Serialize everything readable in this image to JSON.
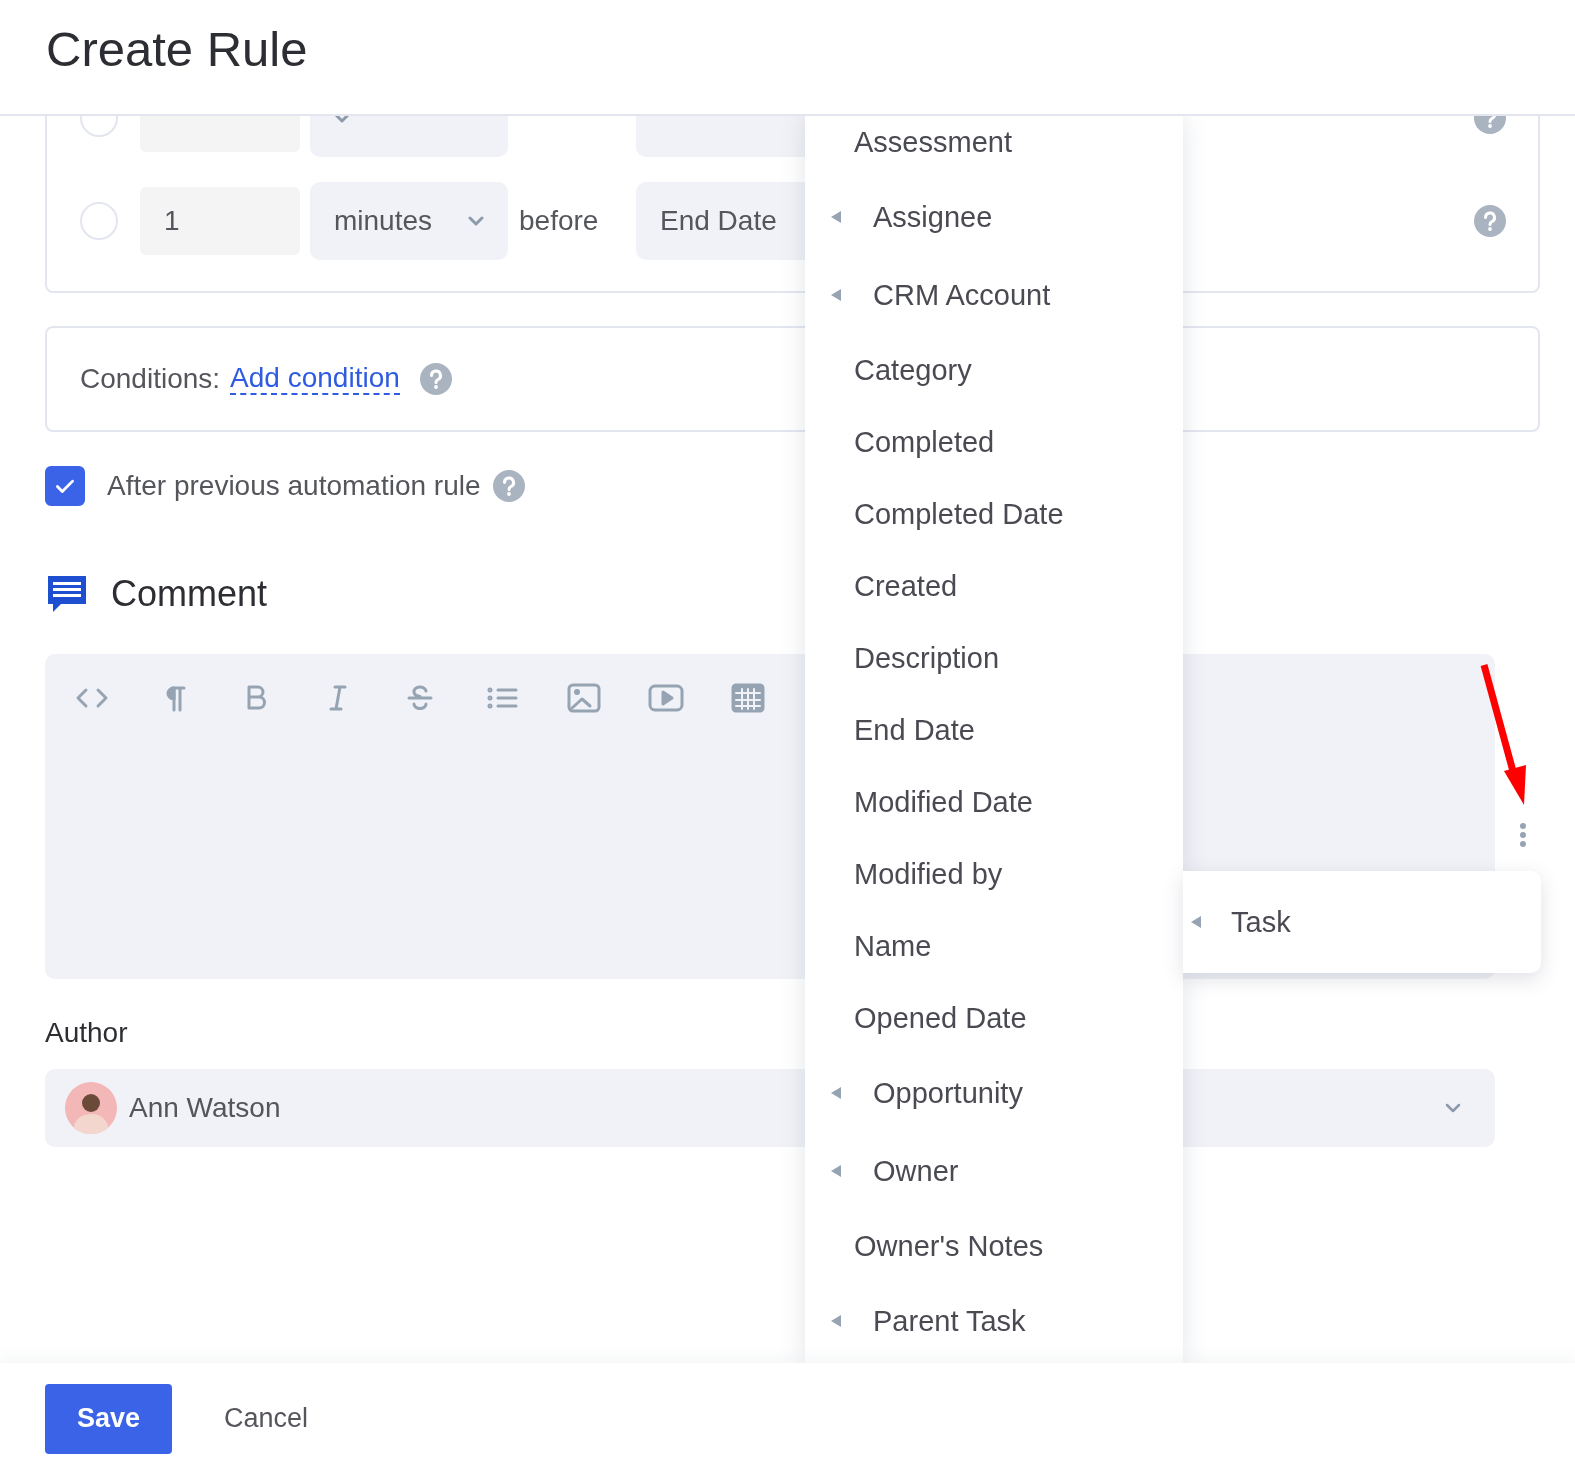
{
  "header": {
    "title": "Create Rule"
  },
  "timing": {
    "rows": [
      {
        "selected": false
      },
      {
        "selected": false,
        "amount": "1",
        "unit": "minutes",
        "relation": "before",
        "field": "End Date"
      }
    ]
  },
  "conditions": {
    "label": "Conditions:",
    "link": "Add condition"
  },
  "after_previous": {
    "label": "After previous automation rule",
    "checked": true
  },
  "comment": {
    "title": "Comment"
  },
  "author": {
    "label": "Author",
    "value": "Ann Watson"
  },
  "field_menu": {
    "items": [
      {
        "label": "Assessment",
        "expandable": false
      },
      {
        "label": "Assignee",
        "expandable": true
      },
      {
        "label": "CRM Account",
        "expandable": true
      },
      {
        "label": "Category",
        "expandable": false
      },
      {
        "label": "Completed",
        "expandable": false
      },
      {
        "label": "Completed Date",
        "expandable": false
      },
      {
        "label": "Created",
        "expandable": false
      },
      {
        "label": "Description",
        "expandable": false
      },
      {
        "label": "End Date",
        "expandable": false
      },
      {
        "label": "Modified Date",
        "expandable": false
      },
      {
        "label": "Modified by",
        "expandable": false
      },
      {
        "label": "Name",
        "expandable": false
      },
      {
        "label": "Opened Date",
        "expandable": false
      },
      {
        "label": "Opportunity",
        "expandable": true
      },
      {
        "label": "Owner",
        "expandable": true
      },
      {
        "label": "Owner's Notes",
        "expandable": false
      },
      {
        "label": "Parent Task",
        "expandable": true
      }
    ]
  },
  "submenu": {
    "items": [
      {
        "label": "Task",
        "expandable": true
      }
    ]
  },
  "footer": {
    "buttons": [
      {
        "label": "Save",
        "kind": "primary"
      },
      {
        "label": "Cancel",
        "kind": "secondary"
      }
    ]
  }
}
